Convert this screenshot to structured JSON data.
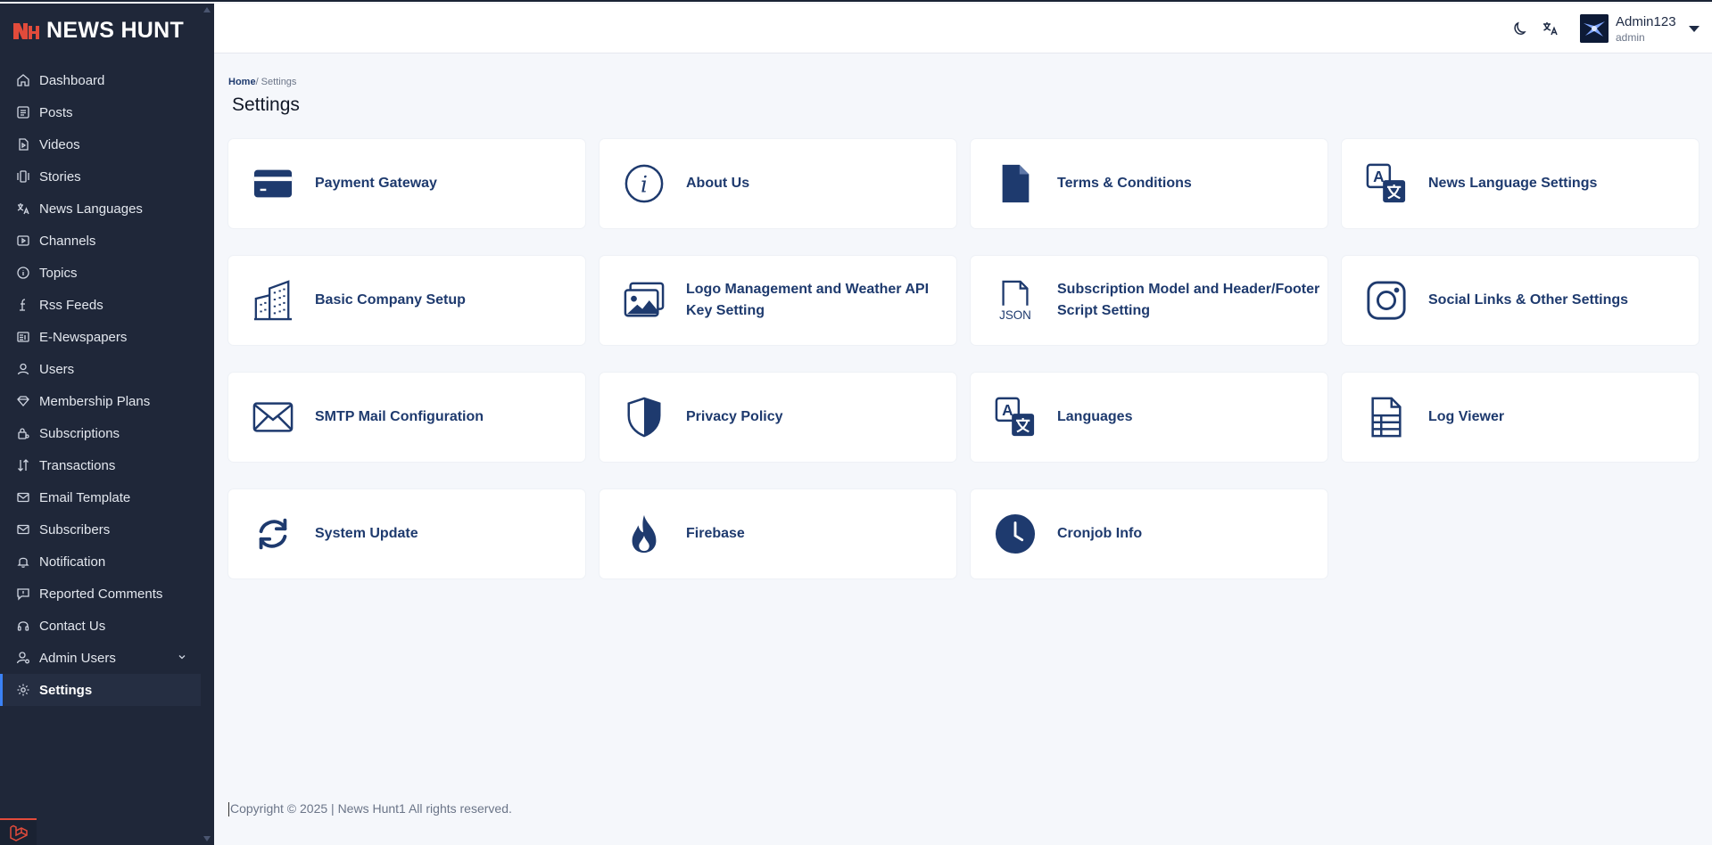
{
  "brand": {
    "name": "NEWS HUNT"
  },
  "sidebar": {
    "items": [
      {
        "label": "Dashboard",
        "icon": "home-icon"
      },
      {
        "label": "Posts",
        "icon": "list-icon"
      },
      {
        "label": "Videos",
        "icon": "video-icon"
      },
      {
        "label": "Stories",
        "icon": "stories-icon"
      },
      {
        "label": "News Languages",
        "icon": "translate-icon"
      },
      {
        "label": "Channels",
        "icon": "play-box-icon"
      },
      {
        "label": "Topics",
        "icon": "info-circle-icon"
      },
      {
        "label": "Rss Feeds",
        "icon": "rss-icon"
      },
      {
        "label": "E-Newspapers",
        "icon": "newspaper-icon"
      },
      {
        "label": "Users",
        "icon": "user-icon"
      },
      {
        "label": "Membership Plans",
        "icon": "diamond-icon"
      },
      {
        "label": "Subscriptions",
        "icon": "lock-user-icon"
      },
      {
        "label": "Transactions",
        "icon": "sort-arrows-icon"
      },
      {
        "label": "Email Template",
        "icon": "mail-icon"
      },
      {
        "label": "Subscribers",
        "icon": "mail-icon"
      },
      {
        "label": "Notification",
        "icon": "bell-icon"
      },
      {
        "label": "Reported Comments",
        "icon": "comment-alert-icon"
      },
      {
        "label": "Contact Us",
        "icon": "headset-icon"
      },
      {
        "label": "Admin Users",
        "icon": "user-gear-icon"
      },
      {
        "label": "Settings",
        "icon": "gear-icon"
      }
    ],
    "active": "Settings"
  },
  "header": {
    "user_name": "Admin123",
    "user_role": "admin"
  },
  "breadcrumb": {
    "home": "Home",
    "separator": "/",
    "current": " Settings"
  },
  "page": {
    "title": "Settings"
  },
  "cards": [
    {
      "label": "Payment Gateway",
      "icon": "credit-card-icon"
    },
    {
      "label": "About Us",
      "icon": "info-circle-icon"
    },
    {
      "label": "Terms & Conditions",
      "icon": "file-icon"
    },
    {
      "label": "News Language Settings",
      "icon": "translate-icon"
    },
    {
      "label": "Basic Company Setup",
      "icon": "building-icon"
    },
    {
      "label": "Logo Management and Weather API Key Setting",
      "icon": "images-icon"
    },
    {
      "label": "Subscription Model and Header/Footer Script Setting",
      "icon": "json-file-icon"
    },
    {
      "label": "Social Links & Other Settings",
      "icon": "instagram-icon"
    },
    {
      "label": "SMTP Mail Configuration",
      "icon": "envelope-icon"
    },
    {
      "label": "Privacy Policy",
      "icon": "shield-icon"
    },
    {
      "label": "Languages",
      "icon": "translate-icon"
    },
    {
      "label": "Log Viewer",
      "icon": "file-list-icon"
    },
    {
      "label": "System Update",
      "icon": "sync-icon"
    },
    {
      "label": "Firebase",
      "icon": "fire-icon"
    },
    {
      "label": "Cronjob Info",
      "icon": "clock-icon"
    }
  ],
  "footer": {
    "text": "Copyright © 2025 | News Hunt1 All rights reserved."
  },
  "colors": {
    "sidebar_bg": "#1f2739",
    "accent": "#1e3a6e",
    "active_bar": "#3b82f6",
    "brand_red": "#e24b3b"
  }
}
